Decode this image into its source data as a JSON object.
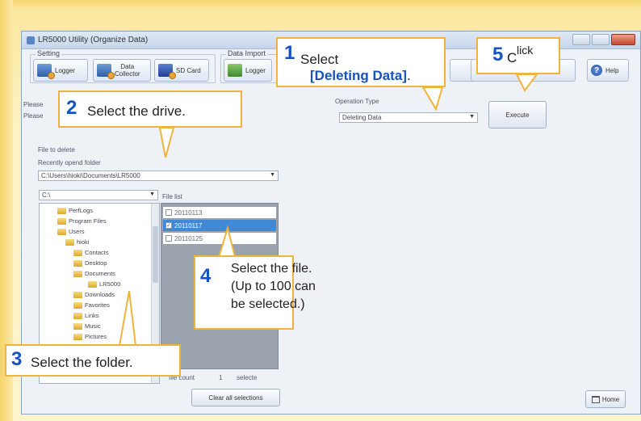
{
  "window": {
    "title": "LR5000 Utility (Organize Data)",
    "close_label": "✕"
  },
  "toolbar": {
    "setting_group_label": "Setting",
    "logger_label": "Logger",
    "data_collector_label": "Data\nCollector",
    "sd_card_label": "SD Card",
    "data_import_group_label": "Data Import",
    "import_logger_label": "Logger",
    "help_label": "Help"
  },
  "instructions": {
    "line1": "Please",
    "line2": "Please"
  },
  "operation": {
    "label": "Operation Type",
    "selected": "Deleting Data",
    "execute_label": "Execute"
  },
  "file_to_delete": {
    "label": "File to delete",
    "recent_label": "Recently opend folder",
    "recent_path": "C:\\Users\\hioki\\Documents\\LR5000",
    "drive": "C:\\"
  },
  "tree": {
    "items": [
      {
        "label": "PerfLogs"
      },
      {
        "label": "Program Files"
      },
      {
        "label": "Users"
      },
      {
        "label": "hioki"
      },
      {
        "label": "Contacts"
      },
      {
        "label": "Desktop"
      },
      {
        "label": "Documents"
      },
      {
        "label": "LR5000"
      },
      {
        "label": "Downloads"
      },
      {
        "label": "Favorites"
      },
      {
        "label": "Links"
      },
      {
        "label": "Music"
      },
      {
        "label": "Pictures"
      }
    ]
  },
  "file_list": {
    "label": "File list",
    "files": [
      {
        "name": "20110113",
        "checked": false
      },
      {
        "name": "20110117",
        "checked": true
      },
      {
        "name": "20110125",
        "checked": false
      }
    ],
    "file_count_label": "file count",
    "file_count": "1",
    "select_label": "selecte",
    "clear_button": "Clear all selections"
  },
  "home_button": "Home",
  "callouts": {
    "c1_num": "1",
    "c1_text": "Select",
    "c1_bracket": "[Deleting Data]",
    "c1_period": ".",
    "c2_num": "2",
    "c2_text": "Select the drive.",
    "c3_num": "3",
    "c3_text": "Select the folder.",
    "c4_num": "4",
    "c4_line1": "Select the file.",
    "c4_line2": "(Up to 100 can",
    "c4_line3": "be selected.)",
    "c5_num": "5",
    "c5_c": "C",
    "c5_rest": "lick"
  },
  "colors": {
    "background": "#fdf0b8",
    "callout_border": "#f0b43b",
    "step_number": "#1552c4",
    "selection": "#3f89d6"
  }
}
